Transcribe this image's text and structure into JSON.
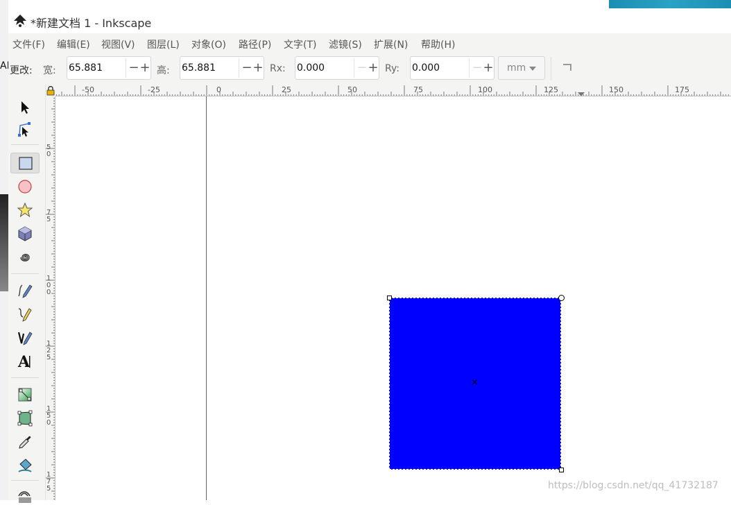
{
  "background": {
    "left_label": "AI"
  },
  "window": {
    "title": "*新建文档 1 - Inkscape"
  },
  "menu": [
    "文件(F)",
    "编辑(E)",
    "视图(V)",
    "图层(L)",
    "对象(O)",
    "路径(P)",
    "文字(T)",
    "滤镜(S)",
    "扩展(N)",
    "帮助(H)"
  ],
  "tool_controls": {
    "change_label": "更改:",
    "width": {
      "label": "宽:",
      "value": "65.881"
    },
    "height": {
      "label": "高:",
      "value": "65.881"
    },
    "rx": {
      "label": "Rx:",
      "value": "0.000"
    },
    "ry": {
      "label": "Ry:",
      "value": "0.000"
    },
    "unit": "mm"
  },
  "toolbox": [
    {
      "name": "selector-tool-icon",
      "active": false
    },
    {
      "name": "node-tool-icon",
      "active": false
    },
    {
      "name": "rectangle-tool-icon",
      "active": true
    },
    {
      "name": "ellipse-tool-icon",
      "active": false
    },
    {
      "name": "star-tool-icon",
      "active": false
    },
    {
      "name": "3d-box-tool-icon",
      "active": false
    },
    {
      "name": "spiral-tool-icon",
      "active": false
    },
    {
      "name": "pencil-tool-icon",
      "active": false
    },
    {
      "name": "pen-tool-icon",
      "active": false
    },
    {
      "name": "calligraphy-tool-icon",
      "active": false
    },
    {
      "name": "text-tool-icon",
      "active": false
    },
    {
      "name": "gradient-tool-icon",
      "active": false
    },
    {
      "name": "mesh-tool-icon",
      "active": false
    },
    {
      "name": "dropper-tool-icon",
      "active": false
    },
    {
      "name": "paint-bucket-tool-icon",
      "active": false
    },
    {
      "name": "tweak-tool-icon",
      "active": false
    }
  ],
  "ruler": {
    "h_labels": [
      "-50",
      "-25",
      "0",
      "25",
      "50",
      "75",
      "100",
      "125",
      "150",
      "175"
    ],
    "v_labels": [
      "5\n0",
      "7\n5",
      "1\n0\n0",
      "1\n2\n5",
      "1\n5\n0",
      "1\n7\n5"
    ]
  },
  "canvas": {
    "rect_fill": "#0000ff"
  },
  "watermark": "https://blog.csdn.net/qq_41732187"
}
